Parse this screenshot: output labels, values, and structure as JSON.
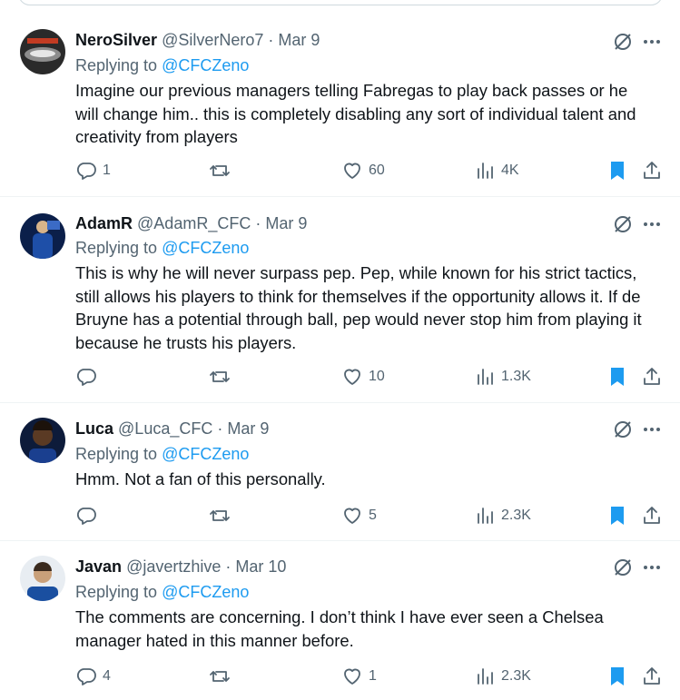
{
  "replies": [
    {
      "name": "NeroSilver",
      "handle": "@SilverNero7",
      "separator": "·",
      "date": "Mar 9",
      "replying_prefix": "Replying to ",
      "replying_to": "@CFCZeno",
      "text": "Imagine our previous managers telling Fabregas to play back passes or he will change him.. this is completely disabling any sort of individual talent and creativity from players",
      "replies_count": "1",
      "likes_count": "60",
      "views_count": "4K",
      "avatar_colors": [
        "#2a2a2a",
        "#8c8c8c",
        "#c23b22"
      ]
    },
    {
      "name": "AdamR",
      "handle": "@AdamR_CFC",
      "separator": "·",
      "date": "Mar 9",
      "replying_prefix": "Replying to ",
      "replying_to": "@CFCZeno",
      "text": "This is why he will never surpass pep. Pep, while known for his strict tactics, still allows his players to think for themselves if the opportunity allows it. If de Bruyne has a potential through ball, pep would never stop him from playing it because he trusts his players.",
      "replies_count": "",
      "likes_count": "10",
      "views_count": "1.3K",
      "avatar_colors": [
        "#0b1f4a",
        "#1e4fa8",
        "#d8b48a"
      ]
    },
    {
      "name": "Luca",
      "handle": "@Luca_CFC",
      "separator": "·",
      "date": "Mar 9",
      "replying_prefix": "Replying to ",
      "replying_to": "@CFCZeno",
      "text": "Hmm. Not a fan of this personally.",
      "replies_count": "",
      "likes_count": "5",
      "views_count": "2.3K",
      "avatar_colors": [
        "#0d1b3a",
        "#5a3a24",
        "#1a3f8f"
      ]
    },
    {
      "name": "Javan",
      "handle": "@javertzhive",
      "separator": "·",
      "date": "Mar 10",
      "replying_prefix": "Replying to ",
      "replying_to": "@CFCZeno",
      "text": "The comments are concerning. I don’t think I have ever seen a Chelsea manager hated in this manner before.",
      "replies_count": "4",
      "likes_count": "1",
      "views_count": "2.3K",
      "avatar_colors": [
        "#e8edf2",
        "#1a4fa0",
        "#c9a07a"
      ]
    }
  ],
  "colors": {
    "text": "#0f1419",
    "secondary": "#536471",
    "link": "#1d9bf0",
    "bookmark": "#1d9bf0",
    "divider": "#eff3f4"
  },
  "icons": {
    "reply": "reply-icon",
    "repost": "repost-icon",
    "like": "heart-icon",
    "views": "views-icon",
    "bookmark": "bookmark-icon",
    "share": "share-icon",
    "grok": "grok-icon",
    "more": "more-icon"
  }
}
